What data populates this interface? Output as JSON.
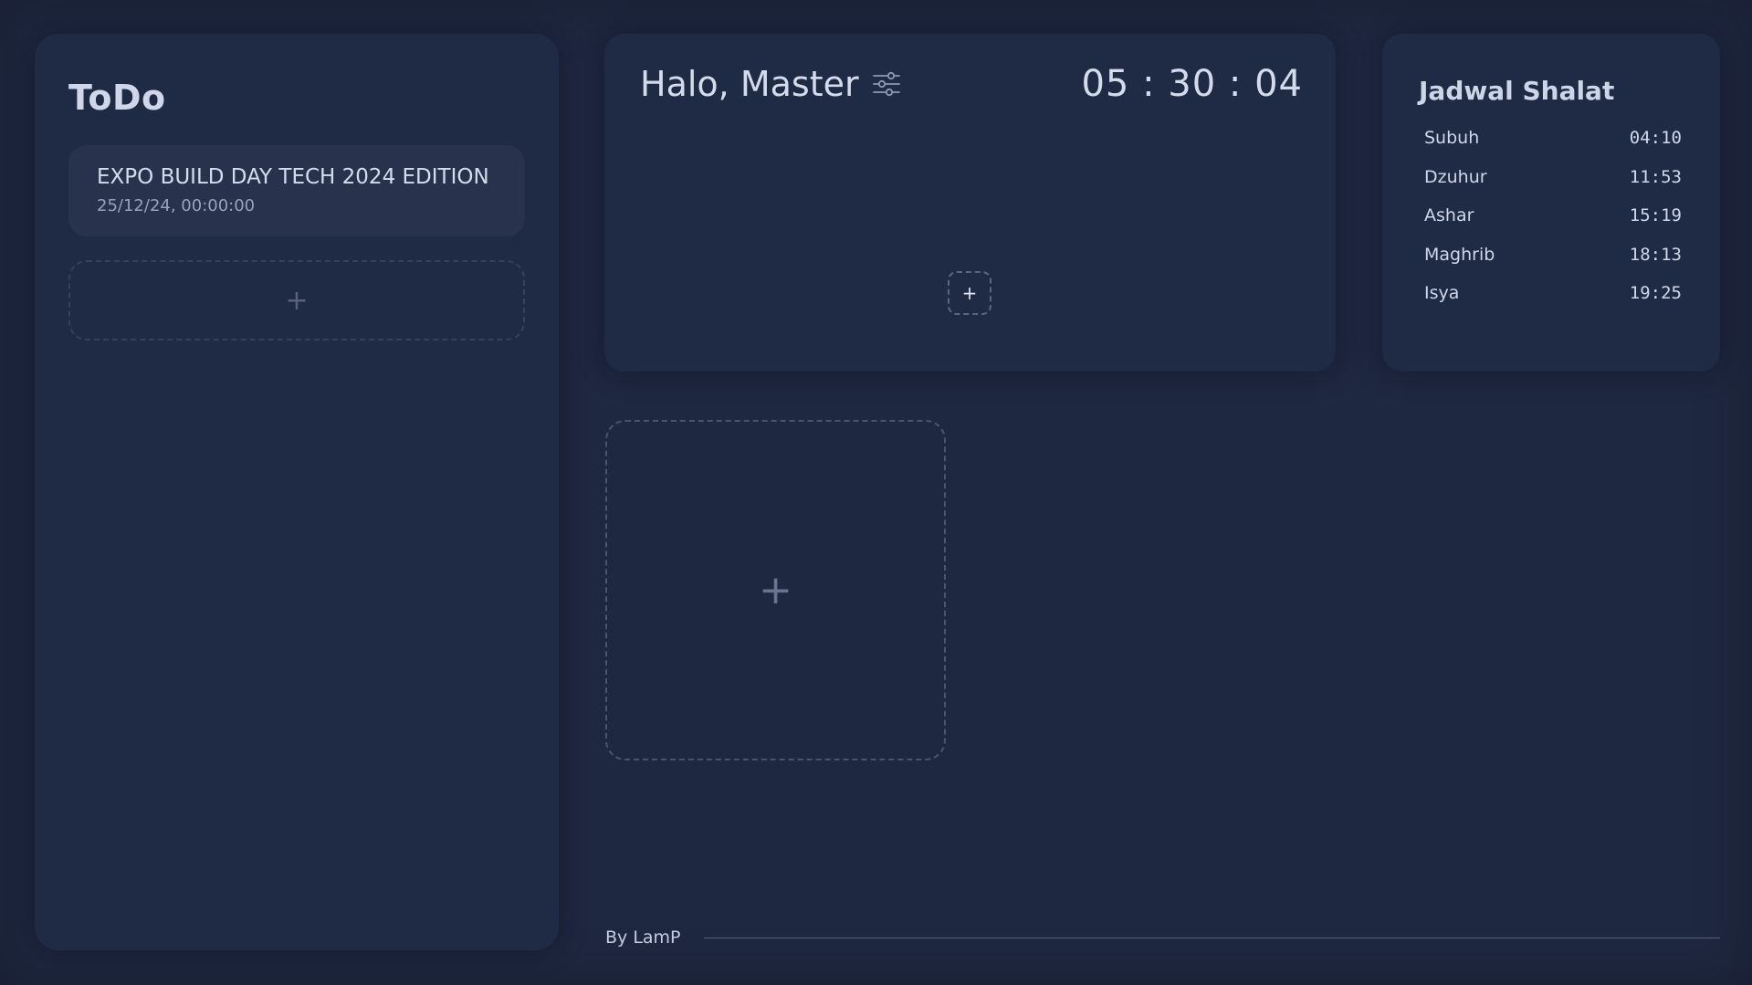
{
  "todo": {
    "title": "ToDo",
    "items": [
      {
        "title": "EXPO BUILD DAY TECH 2024 EDITION",
        "date": "25/12/24, 00:00:00"
      }
    ],
    "add_label": "+"
  },
  "greeting": {
    "text": "Halo, Master",
    "settings_icon": "sliders-icon",
    "clock": "05 : 30 : 04",
    "add_label": "+"
  },
  "prayer": {
    "title": "Jadwal Shalat",
    "times": [
      {
        "name": "Subuh",
        "time": "04:10"
      },
      {
        "name": "Dzuhur",
        "time": "11:53"
      },
      {
        "name": "Ashar",
        "time": "15:19"
      },
      {
        "name": "Maghrib",
        "time": "18:13"
      },
      {
        "name": "Isya",
        "time": "19:25"
      }
    ]
  },
  "widget": {
    "add_label": "+"
  },
  "footer": {
    "text": "By LamP"
  },
  "colors": {
    "background": "#1f2841",
    "panel": "#1f2a44",
    "card": "#28324d",
    "text": "#d4dbec",
    "muted": "#99a2b8"
  }
}
